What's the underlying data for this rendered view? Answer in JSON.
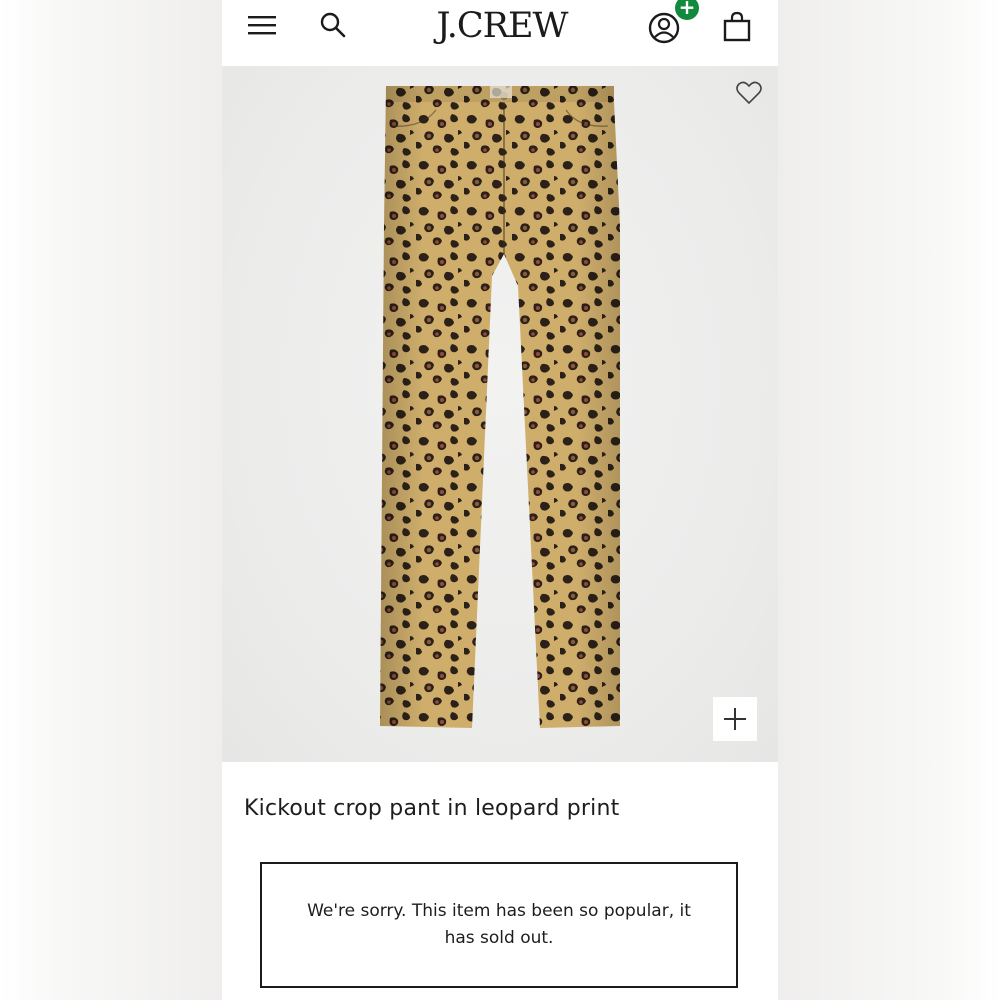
{
  "header": {
    "logo_text": "J.CREW",
    "menu_icon": "hamburger-menu-icon",
    "search_icon": "search-icon",
    "account_icon": "account-icon",
    "account_badge": "+",
    "account_badge_color": "#128a3e",
    "bag_icon": "shopping-bag-icon"
  },
  "product": {
    "image_icon_wishlist": "heart-icon",
    "image_icon_zoom": "plus-icon",
    "title": "Kickout crop pant in leopard print",
    "soldout_message": "We're sorry. This item has been so popular, it has sold out."
  },
  "colors": {
    "leopard_base": "#c9a765",
    "leopard_spot": "#2b2118",
    "leopard_rust": "#9b4a3a"
  }
}
